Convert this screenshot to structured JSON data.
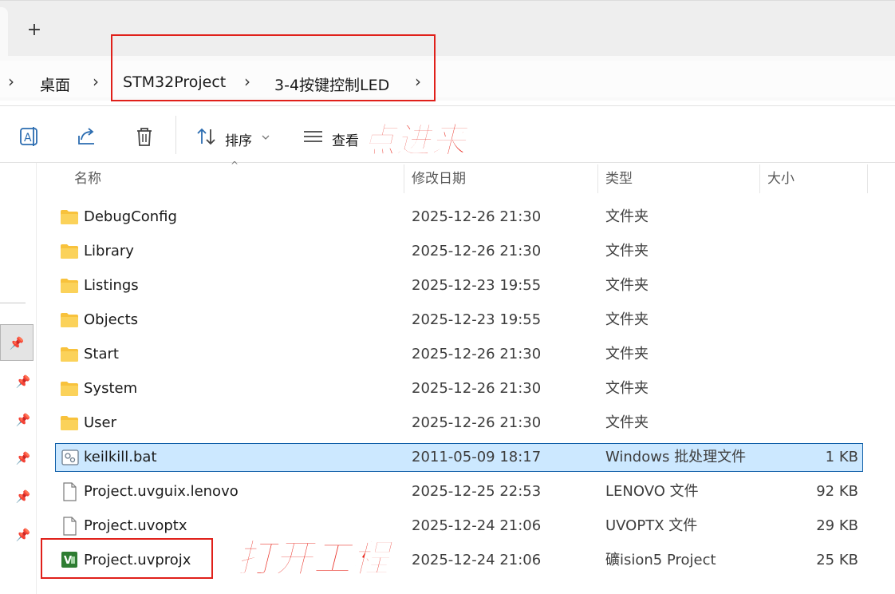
{
  "tabbar": {
    "new_tab_label": "+"
  },
  "breadcrumb": {
    "items": [
      "桌面",
      "STM32Project",
      "3-4按键控制LED"
    ],
    "chevron": "›"
  },
  "toolbar": {
    "sort_label": "排序",
    "view_label": "查看",
    "icons": [
      "rename-icon",
      "share-icon",
      "delete-icon",
      "sort-icon",
      "view-icon"
    ]
  },
  "annotations": {
    "click_in": "点进来",
    "open_project": "打开工程"
  },
  "columns": {
    "name": "名称",
    "modified": "修改日期",
    "type": "类型",
    "size": "大小"
  },
  "files": [
    {
      "name": "DebugConfig",
      "modified": "2025-12-26 21:30",
      "type": "文件夹",
      "size": "",
      "icon": "folder-icon"
    },
    {
      "name": "Library",
      "modified": "2025-12-26 21:30",
      "type": "文件夹",
      "size": "",
      "icon": "folder-icon"
    },
    {
      "name": "Listings",
      "modified": "2025-12-23 19:55",
      "type": "文件夹",
      "size": "",
      "icon": "folder-icon"
    },
    {
      "name": "Objects",
      "modified": "2025-12-23 19:55",
      "type": "文件夹",
      "size": "",
      "icon": "folder-icon"
    },
    {
      "name": "Start",
      "modified": "2025-12-26 21:30",
      "type": "文件夹",
      "size": "",
      "icon": "folder-icon"
    },
    {
      "name": "System",
      "modified": "2025-12-26 21:30",
      "type": "文件夹",
      "size": "",
      "icon": "folder-icon"
    },
    {
      "name": "User",
      "modified": "2025-12-26 21:30",
      "type": "文件夹",
      "size": "",
      "icon": "folder-icon"
    },
    {
      "name": "keilkill.bat",
      "modified": "2011-05-09 18:17",
      "type": "Windows 批处理文件",
      "size": "1 KB",
      "icon": "batch-file-icon",
      "selected": true
    },
    {
      "name": "Project.uvguix.lenovo",
      "modified": "2025-12-25 22:53",
      "type": "LENOVO 文件",
      "size": "92 KB",
      "icon": "file-icon"
    },
    {
      "name": "Project.uvoptx",
      "modified": "2025-12-24 21:06",
      "type": "UVOPTX 文件",
      "size": "29 KB",
      "icon": "file-icon"
    },
    {
      "name": "Project.uvprojx",
      "modified": "2025-12-24 21:06",
      "type": "礦ision5 Project",
      "size": "25 KB",
      "icon": "keil-project-icon"
    }
  ],
  "colors": {
    "selection_bg": "#cce8ff",
    "selection_border": "#0f5ea8",
    "annotation_red": "#e8261c",
    "folder_yellow": "#f8c23c",
    "keil_green": "#2e7d32"
  }
}
